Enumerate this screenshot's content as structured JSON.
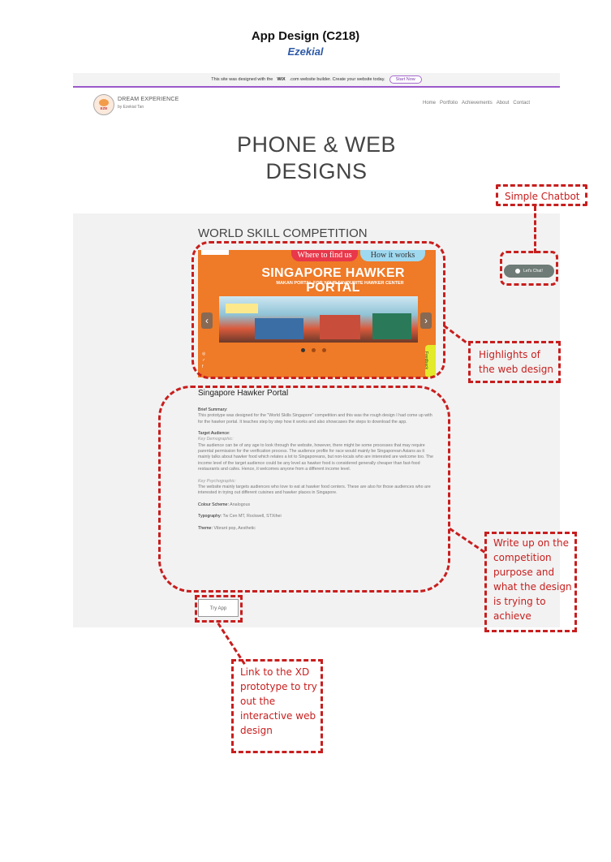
{
  "document": {
    "title": "App Design (C218)",
    "author": "Ezekial"
  },
  "wix_banner": {
    "text_before": "This site was designed with the",
    "wix_logo": "WiX",
    "text_after": ".com website builder. Create your website today.",
    "button": "Start Now"
  },
  "site": {
    "brand_name": "DREAM EXPERIENCE",
    "brand_sub": "by Ezekial Tan",
    "logo_text": "EZE",
    "nav": [
      "Home",
      "Portfolio",
      "Achievements",
      "About",
      "Contact"
    ],
    "hero_line1": "PHONE & WEB",
    "hero_line2": "DESIGNS",
    "section_title": "WORLD SKILL COMPETITION",
    "chat_widget": "Let's Chat!"
  },
  "slider": {
    "pill_left": "Where to find us",
    "pill_right": "How it works",
    "title": "SINGAPORE HAWKER PORTAL",
    "subtitle": "MAKAN PORTAL FOR YOUR FAVOURITE HAWKER CENTER",
    "feedback": "Feedback",
    "arrow_left": "‹",
    "arrow_right": "›",
    "socials": [
      "◎",
      "✓",
      "f"
    ]
  },
  "project": {
    "title": "Singapore Hawker Portal",
    "brief_label": "Brief Summary:",
    "brief_text": "This prototype was designed for the \"World Skills Singapore\" competition and this was the rough design I had come up with for the hawker portal. It teaches step by step how it works and also showcases the steps to download the app.",
    "audience_label": "Target Audience:",
    "demographic_label": "Key Demographic:",
    "demographic_text": "The audience can be of any age to look through the website, however, there might be some processes that may require parental permission for the verification process. The audience profile for race would mainly be Singaporean Asians as it mainly talks about hawker food which relates a lot to Singaporeans, but non-locals who are interested are welcome too. The income level of the target audience could be any level as hawker food is considered generally cheaper than fast-food restaurants and cafes. Hence, it welcomes anyone from a different income level.",
    "psychographic_label": "Key Psychographic:",
    "psychographic_text": "The website mainly targets audiences who love to eat at hawker food centers. These are also for those audiences who are interested in trying out different cuisines and hawker places in Singapore.",
    "colour_label": "Colour Scheme:",
    "colour_value": "Analogous",
    "typography_label": "Typography:",
    "typography_value": "Tw Cen MT, Rockwell, STXihei",
    "theme_label": "Theme:",
    "theme_value": "Vibrant pop, Aesthetic",
    "try_app": "Try App"
  },
  "annotations": {
    "chatbot": "Simple Chatbot",
    "highlights": [
      "Highlights of",
      "the web design"
    ],
    "writeup": [
      "Write up on the",
      "competition",
      "purpose and",
      "what the design",
      "is trying to",
      "achieve"
    ],
    "try_app": [
      "Link to the XD",
      "prototype to try",
      "out the",
      "interactive web",
      "design"
    ],
    "color": "#c81e1e"
  }
}
